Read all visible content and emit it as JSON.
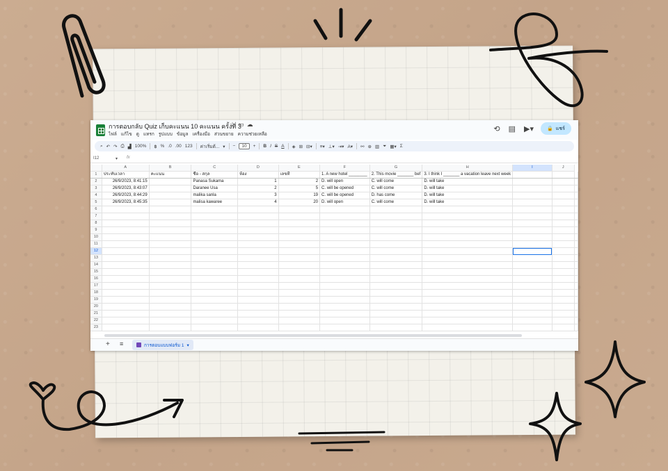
{
  "window": {
    "title": "การตอบกลับ Quiz เก็บคะแนน 10 คะแนน ครั้งที่ 3",
    "menu": [
      "ไฟล์",
      "แก้ไข",
      "ดู",
      "แทรก",
      "รูปแบบ",
      "ข้อมูล",
      "เครื่องมือ",
      "ส่วนขยาย",
      "ความช่วยเหลือ"
    ],
    "share_label": "แชร์"
  },
  "toolbar": {
    "zoom": "100%",
    "currency": "฿",
    "percent": "%",
    "format_123": "123",
    "font_name": "ค่าเริ่มต้...",
    "font_size": "10",
    "bold": "B",
    "italic": "I",
    "strike": "S",
    "text_color": "A",
    "sum": "Σ"
  },
  "formula": {
    "cell_ref": "I12",
    "fx": "fx"
  },
  "columns": [
    "A",
    "B",
    "C",
    "D",
    "E",
    "F",
    "G",
    "H",
    "I",
    "J"
  ],
  "header_row": [
    "ประทับเวลา",
    "คะแนน",
    "ชื่อ - สกุล",
    "ห้อง",
    "เลขที่",
    "1. A new hotel ________",
    "2. This movie _______ bef",
    "3. I think I _______ a vacation leave next week",
    "",
    ""
  ],
  "rows": [
    [
      "26/9/2023, 8:41:15",
      "",
      "Panasa Sukama",
      "1",
      "2",
      "D. will open",
      "C. will come",
      "D. will take",
      "",
      ""
    ],
    [
      "26/9/2023, 8:43:07",
      "",
      "Daranee Usa",
      "2",
      "5",
      "C. will be opened",
      "C. will come",
      "D. will take",
      "",
      ""
    ],
    [
      "26/9/2023, 8:44:29",
      "",
      "malika sanla",
      "3",
      "19",
      "C. will be opened",
      "D. has come",
      "D. will take",
      "",
      ""
    ],
    [
      "26/9/2023, 8:45:35",
      "",
      "malisa kawaree",
      "4",
      "20",
      "D. will open",
      "C. will come",
      "D. will take",
      "",
      ""
    ]
  ],
  "row_numbers": [
    "1",
    "2",
    "3",
    "4",
    "5",
    "6",
    "7",
    "8",
    "9",
    "10",
    "11",
    "12",
    "13",
    "14",
    "15",
    "16",
    "17",
    "18",
    "19",
    "20",
    "21",
    "22",
    "23"
  ],
  "sheet_tab": "การตอบแบบฟอร์ม 1"
}
